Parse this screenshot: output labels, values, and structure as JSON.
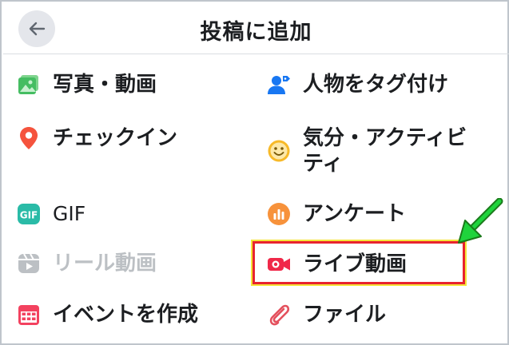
{
  "header": {
    "title": "投稿に追加",
    "back_icon": "arrow-left-icon"
  },
  "options": {
    "photo_video": {
      "label": "写真・動画",
      "icon": "photo-icon",
      "color": "#45bd62"
    },
    "tag_people": {
      "label": "人物をタグ付け",
      "icon": "tag-people-icon",
      "color": "#1877f2"
    },
    "check_in": {
      "label": "チェックイン",
      "icon": "location-pin-icon",
      "color": "#f5533d"
    },
    "feeling": {
      "label_line1": "気分・アクティビ",
      "label_line2": "ティ",
      "icon": "smiley-icon",
      "color": "#f7b928"
    },
    "gif": {
      "label": "GIF",
      "icon": "gif-icon",
      "color": "#2abba7"
    },
    "poll": {
      "label": "アンケート",
      "icon": "poll-icon",
      "color": "#f7923b"
    },
    "reel": {
      "label": "リール動画",
      "icon": "reel-icon",
      "color": "#bcc0c4",
      "disabled": true
    },
    "live": {
      "label": "ライブ動画",
      "icon": "live-video-icon",
      "color": "#f02849"
    },
    "event": {
      "label": "イベントを作成",
      "icon": "calendar-icon",
      "color": "#f3425f"
    },
    "file": {
      "label": "ファイル",
      "icon": "paperclip-icon",
      "color": "#e4505d"
    }
  },
  "annotation": {
    "highlight_color": "#e8232e",
    "arrow_color": "#1fd33c"
  }
}
